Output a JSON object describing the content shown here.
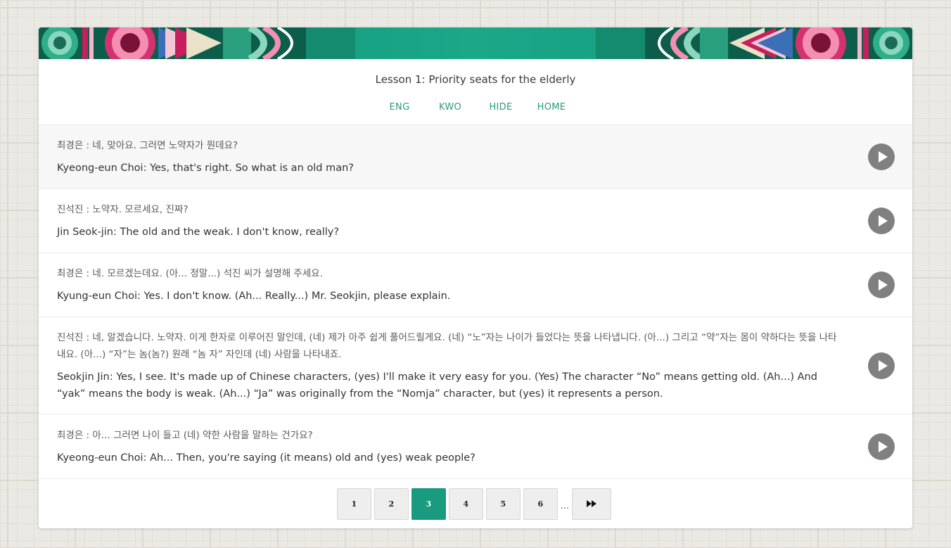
{
  "lesson": {
    "title": "Lesson 1: Priority seats for the elderly"
  },
  "nav": {
    "eng": "ENG",
    "kwo": "KWO",
    "hide": "HIDE",
    "home": "HOME"
  },
  "dialogue": [
    {
      "korean": "최경은 : 네, 맞아요. 그러면 노약자가 뭔데요?",
      "english": "Kyeong-eun Choi: Yes, that's right. So what is an old man?"
    },
    {
      "korean": "진석진 : 노약자. 모르세요, 진짜?",
      "english": "Jin Seok-jin: The old and the weak. I don't know, really?"
    },
    {
      "korean": "최경은 : 네. 모르겠는데요. (아... 정말...) 석진 씨가 설명해 주세요.",
      "english": "Kyung-eun Choi: Yes. I don't know. (Ah... Really...) Mr. Seokjin, please explain."
    },
    {
      "korean": "진석진 : 네, 알겠습니다. 노약자. 이게 한자로 이루어진 말인데, (네) 제가 아주 쉽게 풀어드릴게요. (네) “노”자는 나이가 들었다는 뜻을 나타냅니다. (아...) 그리고 “약”자는 몸이 약하다는 뜻을 나타내요. (아...) “자”는 놈(놈?) 원래 “놈 자” 자인데 (네) 사람을 나타내죠.",
      "english": "Seokjin Jin: Yes, I see. It's made up of Chinese characters, (yes) I'll make it very easy for you. (Yes) The character “No” means getting old. (Ah...) And “yak” means the body is weak. (Ah...) “Ja” was originally from the “Nomja” character, but (yes) it represents a person."
    },
    {
      "korean": "최경은 : 아... 그러면 나이 들고 (네) 약한 사람을 말하는 건가요?",
      "english": "Kyeong-eun Choi: Ah... Then, you're saying (it means) old and (yes) weak people?"
    }
  ],
  "pagination": {
    "pages": [
      "1",
      "2",
      "3",
      "4",
      "5",
      "6"
    ],
    "current": "3",
    "ellipsis": "...",
    "next_icon": "fast-forward-icon"
  },
  "colors": {
    "accent": "#1a9a7e",
    "nav_link": "#2a9a7c",
    "play_button": "#808080"
  }
}
